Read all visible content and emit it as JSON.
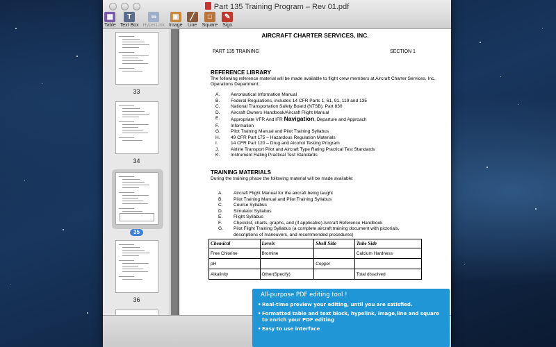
{
  "window": {
    "title": "Part 135 Training Program – Rev 01.pdf"
  },
  "toolbar": [
    {
      "id": "table",
      "label": "Table",
      "icon": "table-icon",
      "color": "#7a5ba8",
      "enabled": true
    },
    {
      "id": "textbox",
      "label": "Text Box",
      "icon": "text-box-icon",
      "color": "#5a6d8c",
      "enabled": true
    },
    {
      "id": "hyperlink",
      "label": "HyperLink",
      "icon": "hyperlink-icon",
      "color": "#9fb0c8",
      "enabled": false
    },
    {
      "id": "image",
      "label": "Image",
      "icon": "image-icon",
      "color": "#c88a3a",
      "enabled": true
    },
    {
      "id": "line",
      "label": "Line",
      "icon": "line-icon",
      "color": "#8c5a3a",
      "enabled": true
    },
    {
      "id": "square",
      "label": "Square",
      "icon": "square-icon",
      "color": "#b8743c",
      "enabled": true
    },
    {
      "id": "sign",
      "label": "Sign",
      "icon": "sign-icon",
      "color": "#c0392b",
      "enabled": true
    }
  ],
  "thumbnails": [
    {
      "page": "33",
      "selected": false
    },
    {
      "page": "34",
      "selected": false
    },
    {
      "page": "35",
      "selected": true
    },
    {
      "page": "36",
      "selected": false
    }
  ],
  "document": {
    "company": "AIRCRAFT CHARTER SERVICES, INC.",
    "header_left": "PART 135 TRAINING",
    "header_right": "SECTION 1",
    "reference": {
      "heading": "REFERENCE LIBRARY",
      "intro": "The following reference material will be made available to flight crew members at Aircraft Charter Services, Inc. Operations Department:",
      "items": [
        {
          "letter": "A.",
          "text": "Aeronautical Information Manual"
        },
        {
          "letter": "B.",
          "text": "Federal Regulations, includes 14 CFR Parts 1, 61, 91, 119 and 135"
        },
        {
          "letter": "C.",
          "text": "National Transportation Safety Board (NTSB), Part 830"
        },
        {
          "letter": "D.",
          "text": "Aircraft Owners Handbook/Aircraft Flight Manual"
        },
        {
          "letter": "E.",
          "text_before": "Appropriate VFR And IFR ",
          "text_emph": "Navigation",
          "text_after": ", Departure and Approach"
        },
        {
          "letter": "F.",
          "text": "Information"
        },
        {
          "letter": "G.",
          "text": "Pilot Training Manual and Pilot Training Syllabus"
        },
        {
          "letter": "H.",
          "text": "49 CFR Part 175 – Hazardous Regulation Materials"
        },
        {
          "letter": "I.",
          "text": "14 CFR Part 120 – Drug and Alcohol Testing Program"
        },
        {
          "letter": "J.",
          "text": "Airline Transport Pilot and Aircraft Type Rating Practical Test Standards"
        },
        {
          "letter": "K.",
          "text": "Instrument Rating Practical Test Standards"
        }
      ]
    },
    "training": {
      "heading": "TRAINING MATERIALS",
      "intro": "During the training phase the following material will be made available:",
      "items": [
        {
          "letter": "A.",
          "text": "Aircraft Flight Manual for the aircraft being taught"
        },
        {
          "letter": "B.",
          "text": "Pilot Training Manual and Pilot Training Syllabus"
        },
        {
          "letter": "C.",
          "text": "Course Syllabus"
        },
        {
          "letter": "D.",
          "text": "Simulator Syllabus"
        },
        {
          "letter": "E.",
          "text": "Flight Syllabus"
        },
        {
          "letter": "F.",
          "text": "Checklist, charts, graphs, and (if applicable) Aircraft Reference Handbook"
        },
        {
          "letter": "G.",
          "text": "Pilot Flight Training Syllabus (a complete aircraft training document with pictorials,"
        },
        {
          "letter": "",
          "text": "descriptions of maneuvers, and recommended procedures)"
        }
      ]
    },
    "table": {
      "headers": [
        "Chemical",
        "Levels",
        "Shell Side",
        "Tube Side"
      ],
      "rows": [
        [
          "Free Chlorine",
          "Bromine",
          "",
          "Calcium Hardness"
        ],
        [
          "pH",
          "",
          "Copper",
          ""
        ],
        [
          "Alkalinity",
          "Other(Specify)",
          "",
          "Total dissolved"
        ]
      ]
    }
  },
  "banner": {
    "title": "All-purpose PDF editing tool !",
    "bullets": [
      "Real-time preview your editing, until you are satisfied.",
      "Formatted table and text block, hypelink, image,line and square to enrich your PDF editing",
      "Easy to use interface"
    ],
    "color": "#2196d6"
  }
}
